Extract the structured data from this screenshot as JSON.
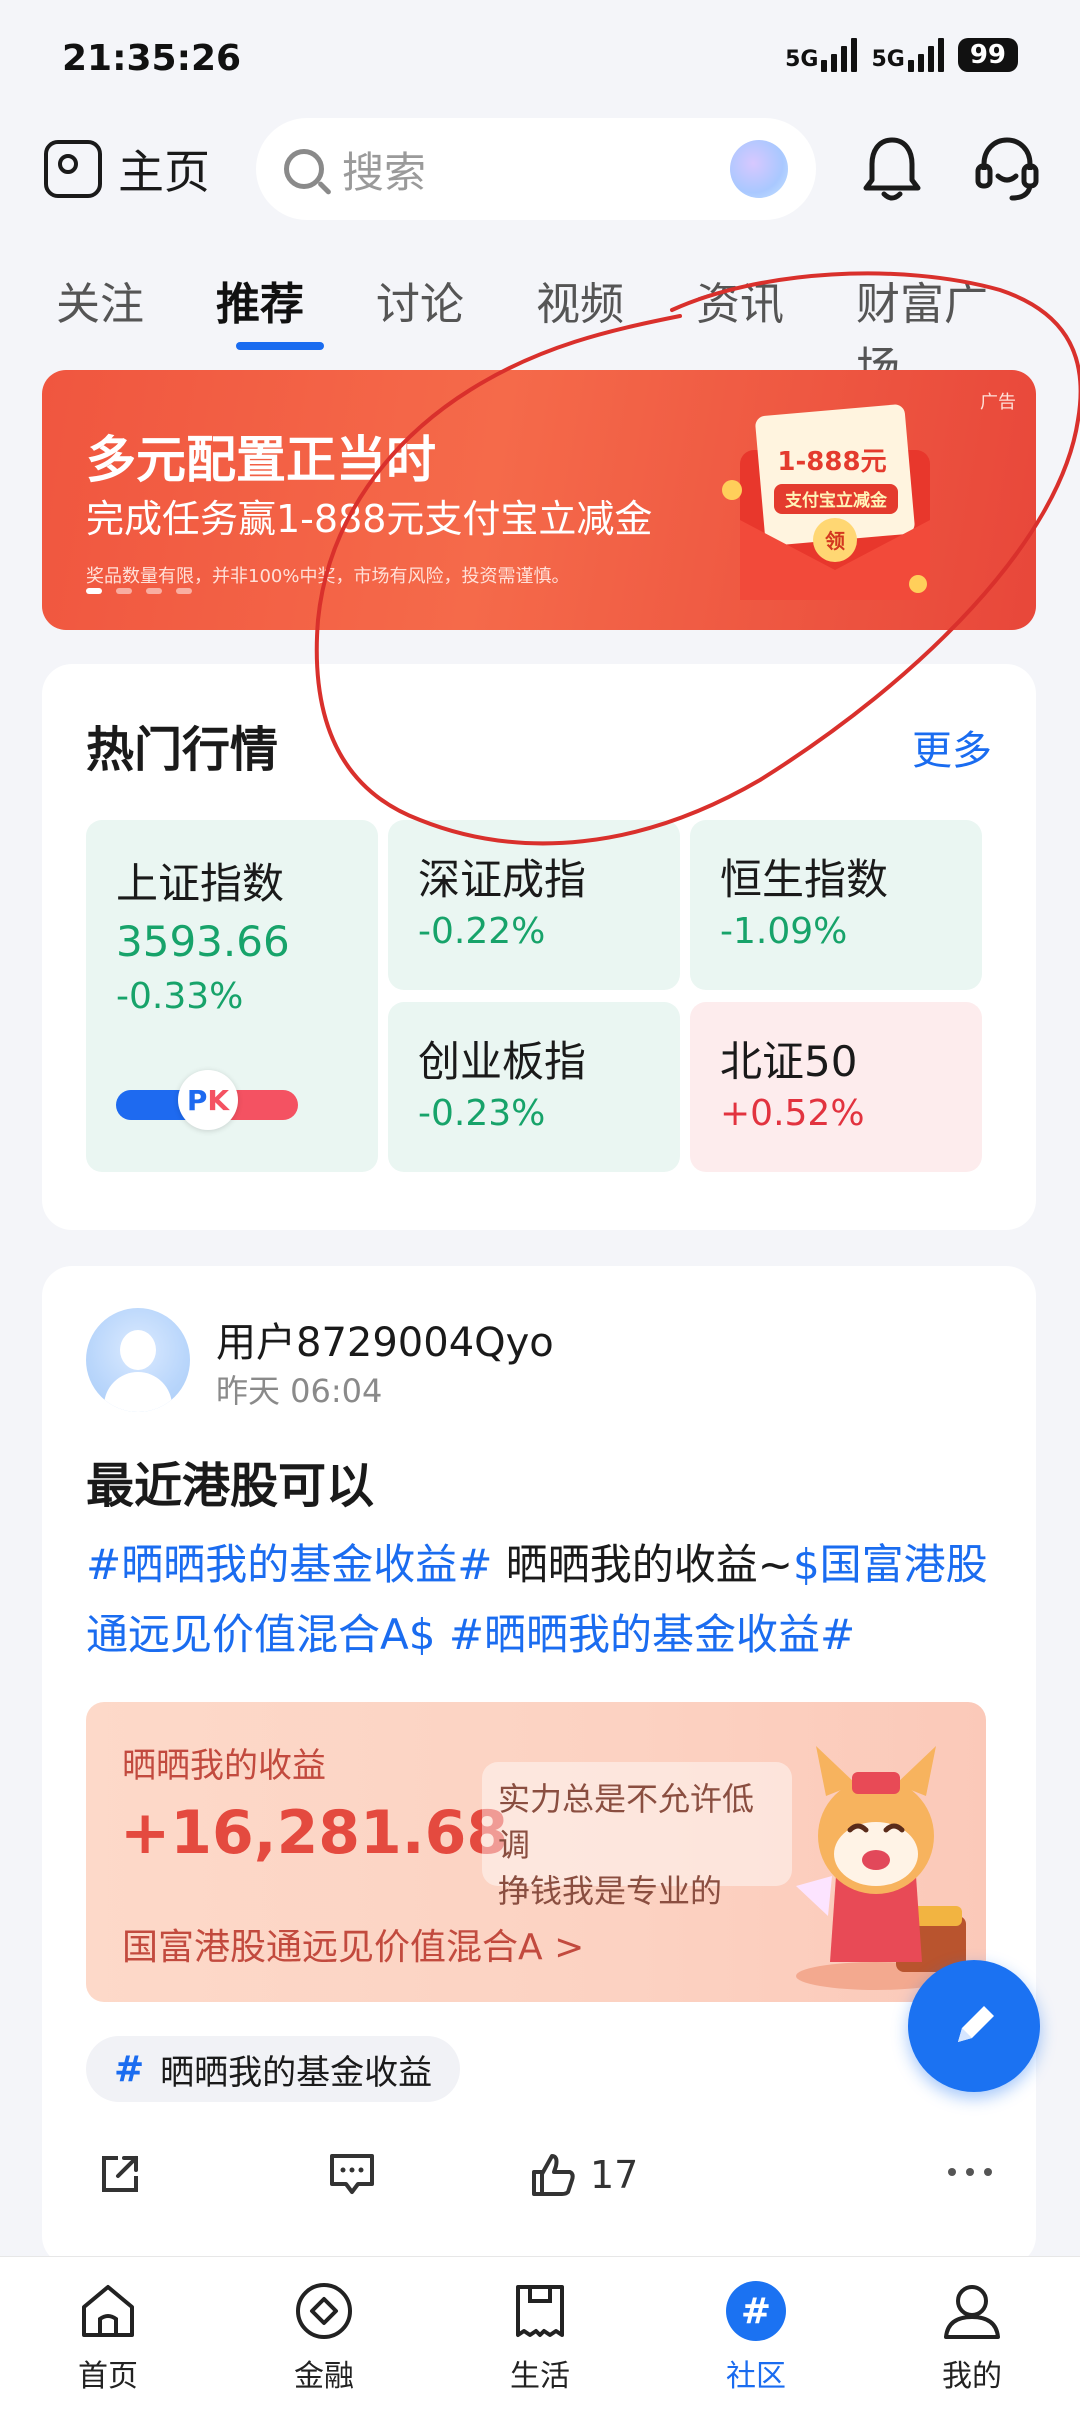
{
  "status_bar": {
    "time": "21:35:26",
    "signal_1": "5G",
    "signal_2": "5G",
    "battery": "99"
  },
  "header": {
    "home_label": "主页",
    "search_placeholder": "搜索"
  },
  "tabs": [
    {
      "label": "关注"
    },
    {
      "label": "推荐",
      "active": true
    },
    {
      "label": "讨论"
    },
    {
      "label": "视频"
    },
    {
      "label": "资讯"
    },
    {
      "label": "财富广场"
    }
  ],
  "banner": {
    "title": "多元配置正当时",
    "subtitle": "完成任务赢1-888元支付宝立减金",
    "note": "奖品数量有限，并非100%中奖，市场有风险，投资需谨慎。",
    "ad_label": "广告",
    "envelope_amount": "1-888元",
    "envelope_text": "支付宝立减金",
    "envelope_button": "领"
  },
  "hot_market": {
    "title": "热门行情",
    "more": "更多",
    "indices": [
      {
        "name": "上证指数",
        "value": "3593.66",
        "change": "-0.33%"
      },
      {
        "name": "深证成指",
        "change": "-0.22%"
      },
      {
        "name": "恒生指数",
        "change": "-1.09%"
      },
      {
        "name": "创业板指",
        "change": "-0.23%"
      },
      {
        "name": "北证50",
        "change": "+0.52%"
      }
    ],
    "pk_label_left": "P",
    "pk_label_right": "K"
  },
  "post": {
    "username": "用户8729004Qyo",
    "time": "昨天 06:04",
    "title": "最近港股可以",
    "body_link1": "#晒晒我的基金收益#",
    "body_text": " 晒晒我的收益~",
    "body_link2": "$国富港股通远见价值混合A$",
    "body_link3": " #晒晒我的基金收益#",
    "earnings_label": "晒晒我的收益",
    "earnings_amount": "+16,281.68",
    "earnings_fund": "国富港股通远见价值混合A >",
    "bubble_line1": "实力总是不允许低调",
    "bubble_line2": "挣钱我是专业的",
    "tag": "晒晒我的基金收益",
    "like_count": "17"
  },
  "bottom_nav": [
    {
      "label": "首页"
    },
    {
      "label": "金融"
    },
    {
      "label": "生活"
    },
    {
      "label": "社区",
      "active": true
    },
    {
      "label": "我的"
    }
  ],
  "colors": {
    "accent": "#1a6cf0",
    "up": "#e2333f",
    "down": "#17a36a",
    "banner": "#f0563f"
  }
}
